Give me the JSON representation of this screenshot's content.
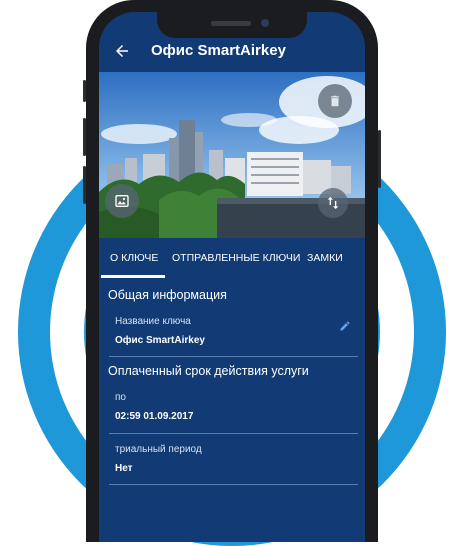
{
  "app": {
    "title": "Офис SmartAirkey"
  },
  "tabs": [
    {
      "label": "О КЛЮЧЕ"
    },
    {
      "label": "ОТПРАВЛЕННЫЕ КЛЮЧИ"
    },
    {
      "label": "ЗАМКИ"
    }
  ],
  "general": {
    "section_title": "Общая информация",
    "key_name_label": "Название ключа",
    "key_name_value": "Офис SmartAirkey"
  },
  "service": {
    "section_title": "Оплаченный срок действия услуги",
    "until_label": "по",
    "until_value": "02:59 01.09.2017",
    "trial_label": "триальный период",
    "trial_value": "Нет"
  },
  "icons": {
    "back": "arrow-back-icon",
    "trash": "trash-icon",
    "image": "image-icon",
    "transfer": "transfer-icon",
    "edit": "pencil-icon"
  },
  "colors": {
    "primary": "#123b76",
    "accent_ring": "#1e98d8",
    "divider": "#5b7cae"
  }
}
